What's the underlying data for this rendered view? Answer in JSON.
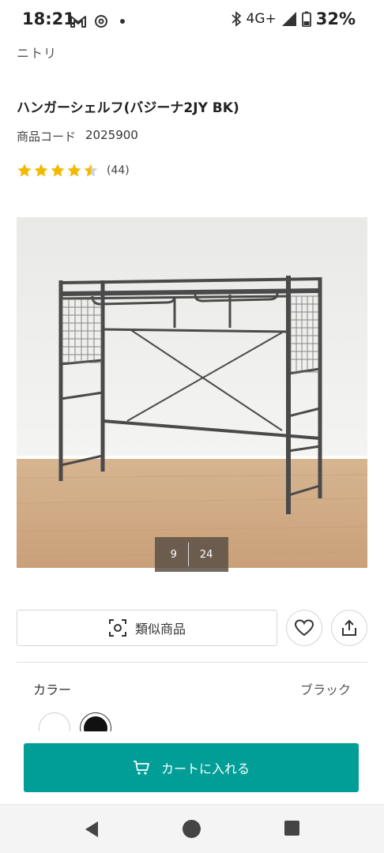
{
  "status_bar": {
    "time": "18:21",
    "network": "4G+",
    "battery": "32%",
    "icons": [
      "gmail-icon",
      "threads-icon",
      "dot-icon",
      "bluetooth-icon",
      "signal-icon",
      "battery-icon"
    ]
  },
  "brand": "ニトリ",
  "product": {
    "title": "ハンガーシェルフ(バジーナ2JY BK)",
    "code_label": "商品コード",
    "code_value": "2025900",
    "rating": 4.5,
    "review_count": "(44)"
  },
  "gallery": {
    "current": "9",
    "total": "24"
  },
  "actions": {
    "similar_label": "類似商品",
    "favorite_icon": "heart-icon",
    "share_icon": "share-icon"
  },
  "color": {
    "label": "カラー",
    "selected": "ブラック",
    "swatches": [
      "#ffffff",
      "#111111"
    ]
  },
  "cart": {
    "label": "カートに入れる",
    "color": "#009e96"
  },
  "nav": {
    "icons": [
      "back-icon",
      "home-icon",
      "recents-icon"
    ]
  }
}
